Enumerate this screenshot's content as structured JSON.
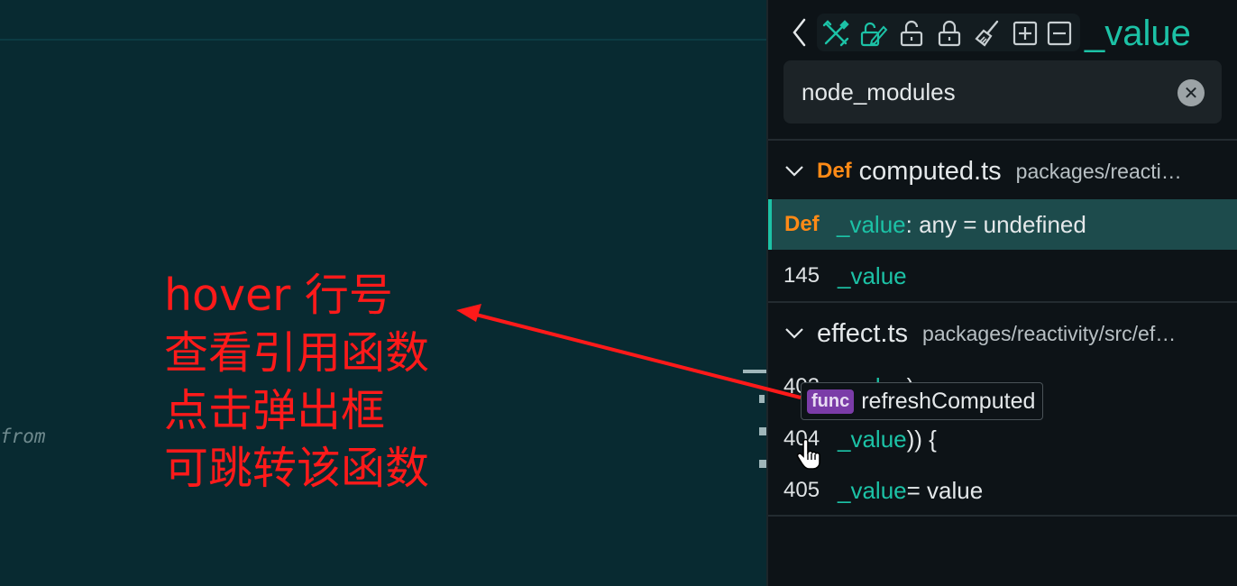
{
  "editor": {
    "code_fragment": "from"
  },
  "annotation": {
    "lines": [
      "hover 行号",
      "查看引用函数",
      "点击弹出框",
      "可跳转该函数"
    ],
    "color": "#ff1a1a"
  },
  "panel": {
    "toolbar": {
      "icons": [
        "chevron-left-icon",
        "tools-icon",
        "edit-lock-icon",
        "unlock-icon",
        "lock-icon",
        "broom-icon",
        "expand-all-icon",
        "collapse-all-icon"
      ],
      "symbol": "_value"
    },
    "search": {
      "value": "node_modules"
    },
    "groups": [
      {
        "kind": "Def",
        "file": "computed.ts",
        "path": "packages/reacti…",
        "rows": [
          {
            "kind": "Def",
            "ident": "_value",
            "rest": ": any = undefined",
            "selected": true
          },
          {
            "line": "145",
            "ident": "_value",
            "rest": ""
          }
        ]
      },
      {
        "file": "effect.ts",
        "path": "packages/reactivity/src/ef…",
        "rows": [
          {
            "line": "403",
            "ident": "_value",
            "rest": ")"
          },
          {
            "line": "404",
            "ident": "_value",
            "rest": ")) {"
          },
          {
            "line": "405",
            "ident": "_value",
            "rest": " = value"
          }
        ]
      }
    ],
    "popup": {
      "badge": "func",
      "name": "refreshComputed"
    }
  },
  "colors": {
    "accent": "#1cc2a6",
    "def": "#ff8a16",
    "editor_bg": "#082a31",
    "panel_bg": "#0d1317"
  }
}
